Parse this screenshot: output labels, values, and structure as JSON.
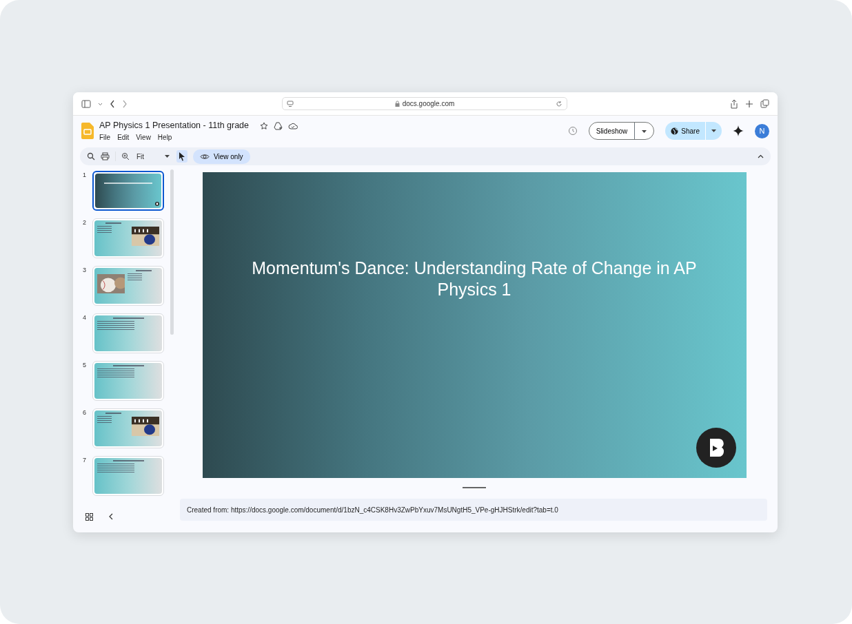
{
  "browser": {
    "address": "docs.google.com"
  },
  "document": {
    "title": "AP Physics 1 Presentation - 11th grade",
    "menu": [
      "File",
      "Edit",
      "View",
      "Help"
    ]
  },
  "header_buttons": {
    "slideshow": "Slideshow",
    "share": "Share",
    "avatar": "N"
  },
  "toolbar": {
    "zoom": "Fit",
    "view_mode": "View only",
    "pointer_selected": true
  },
  "slides": [
    {
      "number": "1",
      "kind": "title",
      "selected": true
    },
    {
      "number": "2",
      "kind": "image-right",
      "selected": false
    },
    {
      "number": "3",
      "kind": "image-left",
      "selected": false
    },
    {
      "number": "4",
      "kind": "bullets",
      "selected": false
    },
    {
      "number": "5",
      "kind": "bullets",
      "selected": false
    },
    {
      "number": "6",
      "kind": "image-right",
      "selected": false
    },
    {
      "number": "7",
      "kind": "bullets",
      "selected": false
    }
  ],
  "current_slide": {
    "title": "Momentum's Dance: Understanding Rate of Change in AP Physics 1"
  },
  "speaker_notes": "Created from: https://docs.google.com/document/d/1bzN_c4CSK8Hv3ZwPbYxuv7MsUNgtH5_VPe-gHJHStrk/edit?tab=t.0"
}
